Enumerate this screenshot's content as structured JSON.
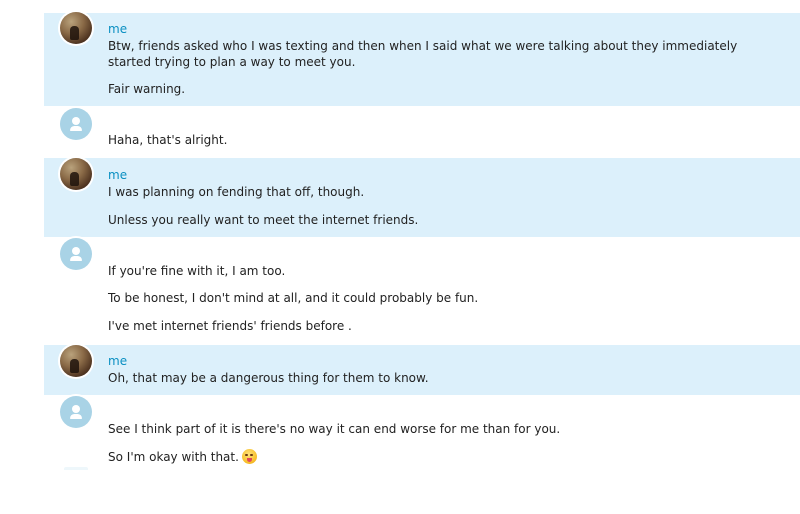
{
  "conversation": {
    "groups": [
      {
        "sender": "me",
        "avatar_icon": "user-photo-avatar",
        "messages": [
          "Btw, friends asked who I was texting and then when I said what we were talking about they immediately started trying to plan a way to meet you.",
          "Fair warning."
        ]
      },
      {
        "avatar_icon": "person-icon",
        "messages": [
          "Haha, that's alright."
        ]
      },
      {
        "sender": "me",
        "avatar_icon": "user-photo-avatar",
        "messages": [
          "I was planning on fending that off, though.",
          "Unless you really want to meet the internet friends."
        ]
      },
      {
        "avatar_icon": "person-icon",
        "messages": [
          "If you're fine with it, I am too.",
          "To be honest, I don't mind at all, and it could probably be fun.",
          "I've met internet friends' friends before ."
        ]
      },
      {
        "sender": "me",
        "avatar_icon": "user-photo-avatar",
        "messages": [
          "Oh, that may be a dangerous thing for them to know."
        ]
      },
      {
        "avatar_icon": "person-icon",
        "messages": [
          "See I think part of it is there's no way it can end worse for me than for you.",
          "So I'm okay with that."
        ],
        "emoji": "tongue-out-emoji-icon"
      }
    ]
  },
  "colors": {
    "mine_background": "#dcf0fb",
    "sender_name": "#0a8fc2",
    "avatar_default": "#a9d3e6"
  }
}
